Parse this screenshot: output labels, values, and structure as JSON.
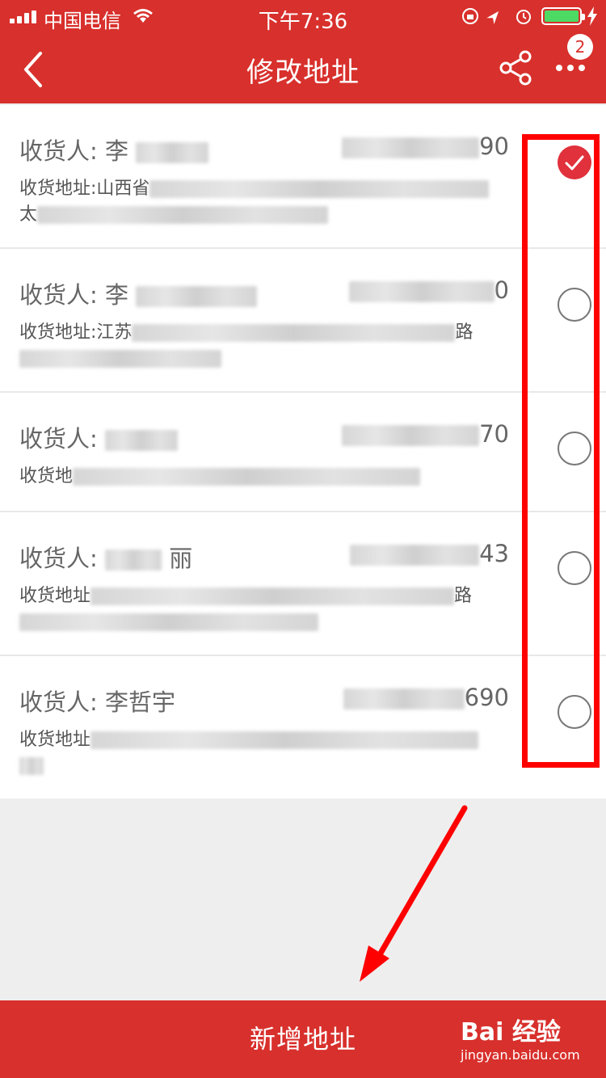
{
  "status_bar": {
    "carrier": "中国电信",
    "time": "下午7:36"
  },
  "nav": {
    "title": "修改地址",
    "badge_count": "2",
    "back_icon": "chevron-left-icon",
    "share_icon": "share-icon",
    "more_icon": "more-dots-icon"
  },
  "addresses": [
    {
      "name_label": "收货人:",
      "name": "李",
      "phone_tail": "90",
      "addr_label": "收货地址:",
      "addr": "山西省",
      "addr2": "太",
      "selected": true
    },
    {
      "name_label": "收货人:",
      "name": "李",
      "phone_tail": "0",
      "addr_label": "收货地址:",
      "addr": "江苏",
      "addr2": "路",
      "selected": false
    },
    {
      "name_label": "收货人:",
      "name": "",
      "phone_tail": "70",
      "addr_label": "收货地",
      "addr": "",
      "addr2": "",
      "selected": false
    },
    {
      "name_label": "收货人:",
      "name": "丽",
      "phone_tail": "43",
      "addr_label": "收货地址",
      "addr": "",
      "addr2": "路",
      "selected": false
    },
    {
      "name_label": "收货人:",
      "name": "李哲宇",
      "phone_tail": "690",
      "addr_label": "收货地址",
      "addr": "",
      "addr2": "",
      "selected": false
    }
  ],
  "bottom_bar": {
    "add_label": "新增地址"
  },
  "watermark": {
    "brand": "Bai 经验",
    "sub": "jingyan.baidu.com"
  },
  "colors": {
    "brand_red": "#d8302c",
    "check_red": "#e0313c",
    "annotation_red": "#ff0000"
  }
}
